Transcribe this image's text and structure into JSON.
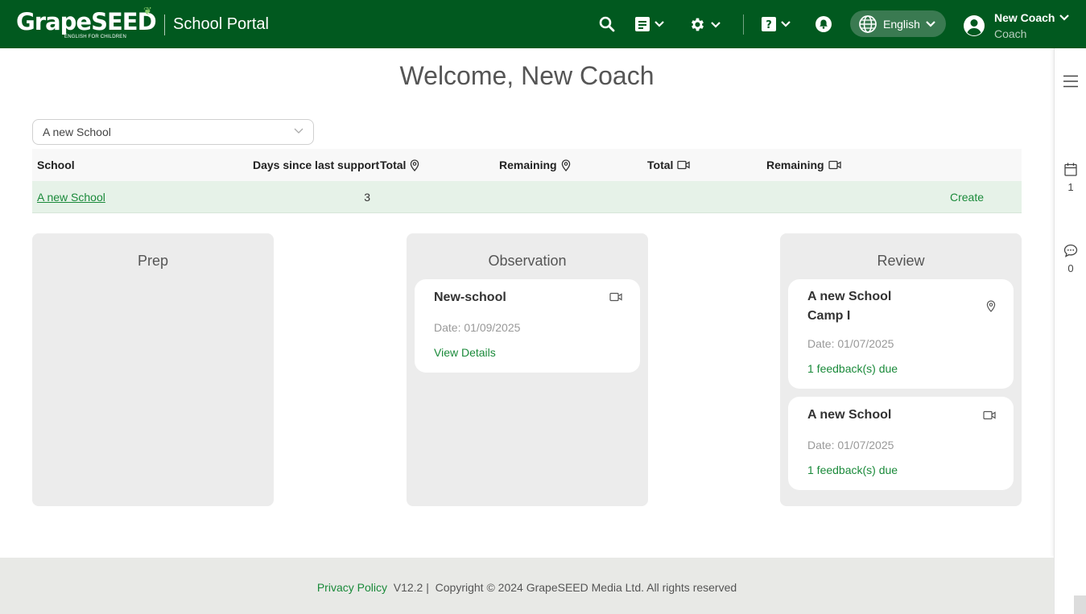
{
  "header": {
    "logo_text": "GrapeSEED",
    "logo_sub": "ENGLISH FOR CHILDREN",
    "portal_title": "School Portal",
    "language": "English",
    "user_name": "New Coach",
    "user_role": "Coach",
    "background_color": "#01591f",
    "icons": [
      "search-icon",
      "document-icon",
      "gear-icon",
      "help-icon",
      "bell-icon",
      "globe-icon",
      "user-avatar-icon"
    ]
  },
  "main": {
    "welcome": "Welcome, New Coach",
    "school_select": {
      "value": "A new School"
    },
    "table": {
      "headers": {
        "school": "School",
        "days": "Days since last support",
        "total_visits": "Total",
        "remaining_visits": "Remaining",
        "total_video": "Total",
        "remaining_video": "Remaining"
      },
      "rows": [
        {
          "school": "A new School",
          "days": "3",
          "total_visits": "",
          "remaining_visits": "",
          "total_video": "",
          "remaining_video": "",
          "action": "Create"
        }
      ]
    },
    "columns": {
      "prep": {
        "title": "Prep"
      },
      "observation": {
        "title": "Observation",
        "cards": [
          {
            "title": "New-school",
            "date": "Date: 01/09/2025",
            "link": "View Details",
            "icon": "video-icon"
          }
        ]
      },
      "review": {
        "title": "Review",
        "cards": [
          {
            "title_line1": "A new School",
            "title_line2": "Camp I",
            "date": "Date: 01/07/2025",
            "link": "1 feedback(s) due",
            "icon": "location-pin-icon"
          },
          {
            "title_line1": "A new School",
            "date": "Date: 01/07/2025",
            "link": "1 feedback(s) due",
            "icon": "video-icon"
          }
        ]
      }
    }
  },
  "right_rail": {
    "calendar_count": "1",
    "chat_count": "0"
  },
  "footer": {
    "privacy": "Privacy Policy",
    "version": "V12.2 |",
    "copyright": "Copyright © 2024 GrapeSEED Media Ltd. All rights reserved"
  },
  "colors": {
    "accent_green": "#1a8a3a",
    "row_highlight": "#e6f2e8",
    "column_bg": "#ececec"
  }
}
